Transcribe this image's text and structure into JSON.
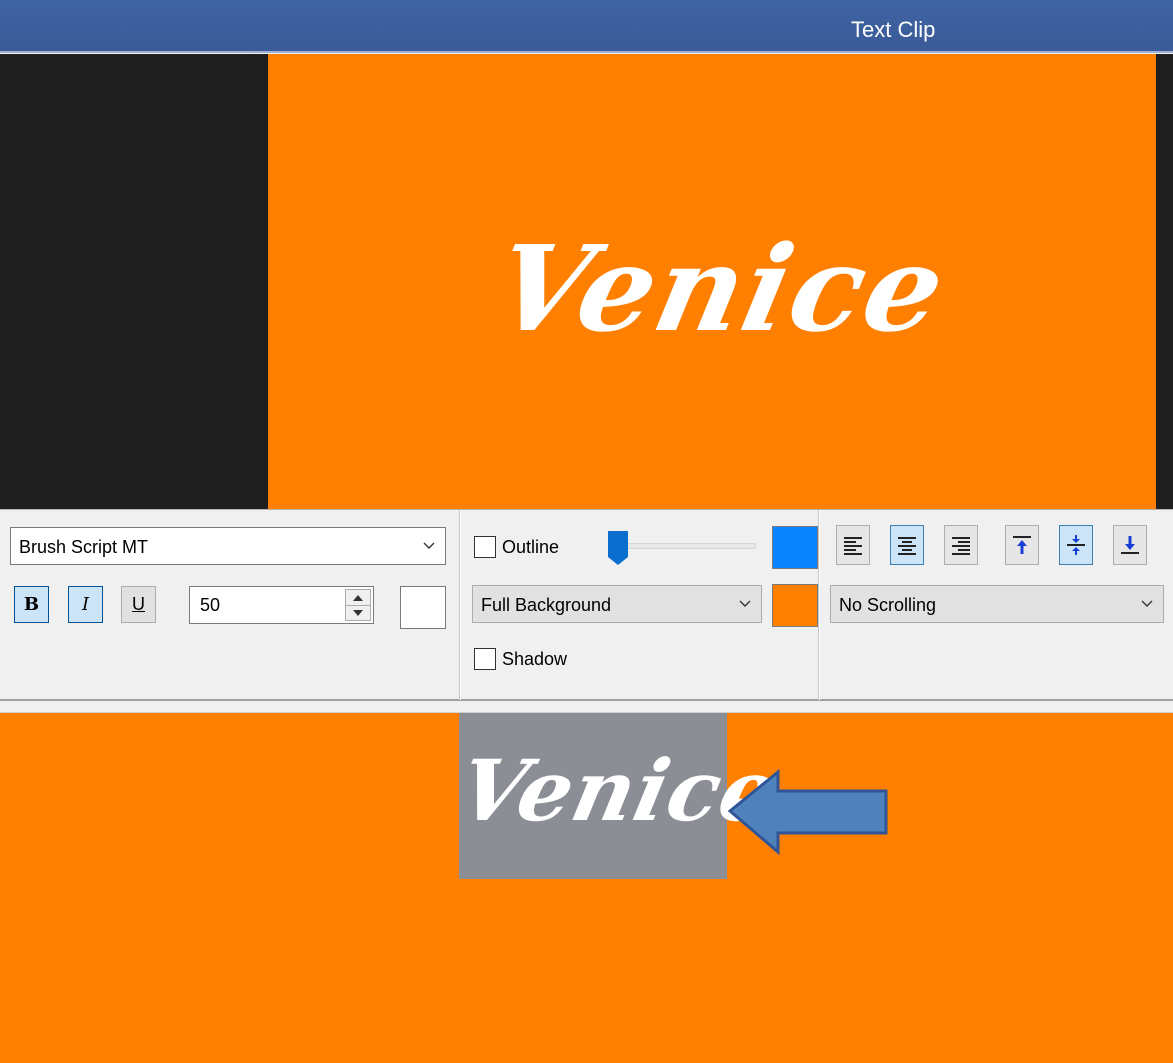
{
  "window": {
    "title": "Text Clip"
  },
  "preview": {
    "text": "Venice"
  },
  "font": {
    "name": "Brush Script MT",
    "size": "50"
  },
  "format": {
    "bold_label": "B",
    "italic_label": "I",
    "underline_label": "U"
  },
  "outline": {
    "label": "Outline",
    "checked": false,
    "color": "#0a84ff"
  },
  "background": {
    "mode": "Full Background",
    "color": "#ff7f00"
  },
  "shadow": {
    "label": "Shadow",
    "checked": false
  },
  "text_color": "#ffffff",
  "scrolling": {
    "mode": "No Scrolling"
  },
  "alignment": {
    "horizontal": [
      "align-left",
      "align-center",
      "align-right"
    ],
    "vertical": [
      "align-top",
      "align-middle",
      "align-bottom"
    ],
    "selected_horizontal": "align-center",
    "selected_vertical": "align-middle"
  },
  "canvas": {
    "text": "Venice"
  },
  "colors": {
    "title_bar": "#3d5f9f",
    "orange": "#ff7f00",
    "selection": "#8b8f95",
    "arrow": "#4f81bd"
  }
}
